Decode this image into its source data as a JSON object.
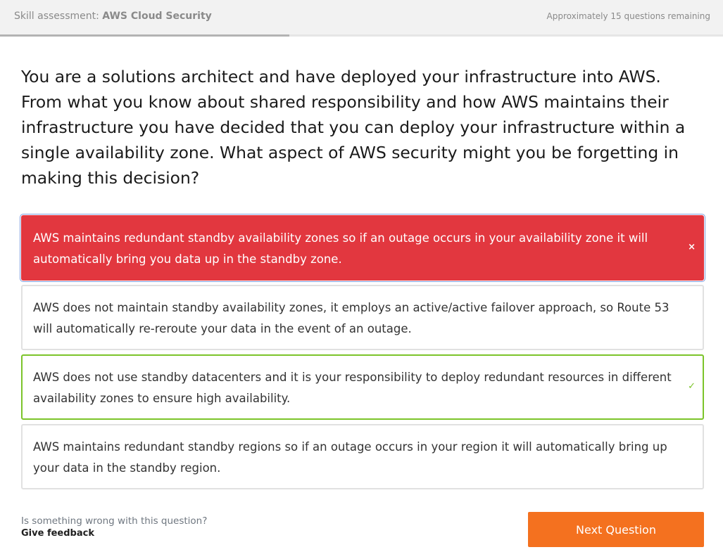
{
  "header": {
    "title_prefix": "Skill assessment: ",
    "course_name": "AWS Cloud Security",
    "remaining_text": "Approximately 15 questions remaining",
    "progress_fraction": 0.4
  },
  "question": {
    "text": "You are a solutions architect and have deployed your infrastructure into AWS. From what you know about shared responsibility and how AWS maintains their infrastructure you have decided that you can deploy your infrastructure within a single availability zone. What aspect of AWS security might you be forgetting in making this decision?"
  },
  "answers": [
    {
      "text": "AWS maintains redundant standby availability zones so if an outage occurs in your availability zone it will automatically bring you data up in the standby zone.",
      "state": "wrong",
      "mark": "×"
    },
    {
      "text": "AWS does not maintain standby availability zones, it employs an active/active failover approach, so Route 53 will automatically re-reroute your data in the event of an outage.",
      "state": "neutral",
      "mark": ""
    },
    {
      "text": "AWS does not use standby datacenters and it is your responsibility to deploy redundant resources in different availability zones to ensure high availability.",
      "state": "correct",
      "mark": "✓"
    },
    {
      "text": "AWS maintains redundant standby regions so if an outage occurs in your region it will automatically bring up your data in the standby region.",
      "state": "neutral",
      "mark": ""
    }
  ],
  "footer": {
    "question_text": "Is something wrong with this question?",
    "feedback_link": "Give feedback",
    "next_button": "Next Question"
  },
  "colors": {
    "wrong": "#e2373f",
    "correct": "#7cc42a",
    "accent": "#f4711f"
  }
}
